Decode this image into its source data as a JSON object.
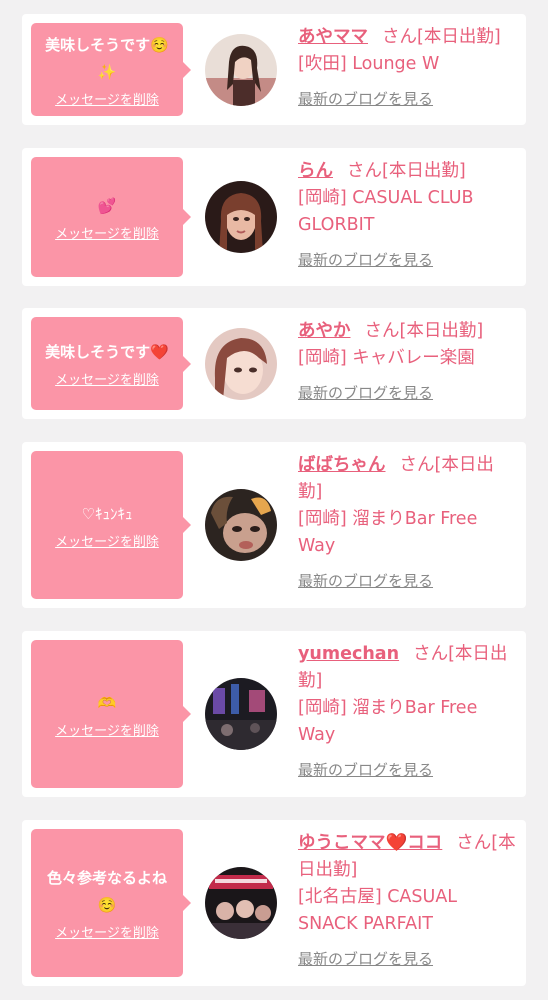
{
  "items": [
    {
      "message": "美味しそうです☺️✨",
      "delete_label": "メッセージを削除",
      "name": "あやママ",
      "suffix": "さん[本日出勤]",
      "shop": "[吹田] Lounge W",
      "blog_label": "最新のブログを見る"
    },
    {
      "message": "💕",
      "delete_label": "メッセージを削除",
      "name": "らん",
      "suffix": "さん[本日出勤]",
      "shop": "[岡崎] CASUAL CLUB GLORBIT",
      "blog_label": "最新のブログを見る"
    },
    {
      "message": "美味しそうです❤️",
      "delete_label": "メッセージを削除",
      "name": "あやか",
      "suffix": "さん[本日出勤]",
      "shop": "[岡崎] キャバレー楽園",
      "blog_label": "最新のブログを見る"
    },
    {
      "message": "♡ｷｭﾝｷｭ",
      "delete_label": "メッセージを削除",
      "name": "ばばちゃん",
      "suffix": "さん[本日出勤]",
      "shop": "[岡崎] 溜まりBar Free Way",
      "blog_label": "最新のブログを見る"
    },
    {
      "message": "🫶",
      "delete_label": "メッセージを削除",
      "name": "yumechan",
      "suffix": "さん[本日出勤]",
      "shop": "[岡崎] 溜まりBar Free Way",
      "blog_label": "最新のブログを見る"
    },
    {
      "message": "色々参考なるよね☺️",
      "delete_label": "メッセージを削除",
      "name": "ゆうこママ❤️ココ",
      "suffix": "さん[本日出勤]",
      "shop": "[北名古屋] CASUAL SNACK PARFAIT",
      "blog_label": "最新のブログを見る"
    }
  ]
}
